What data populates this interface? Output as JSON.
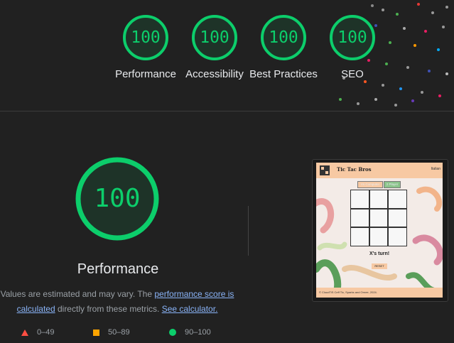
{
  "scores": [
    {
      "label": "Performance",
      "value": "100"
    },
    {
      "label": "Accessibility",
      "value": "100"
    },
    {
      "label": "Best Practices",
      "value": "100"
    },
    {
      "label": "SEO",
      "value": "100"
    }
  ],
  "score_fraction": 1.0,
  "main": {
    "score": "100",
    "title": "Performance",
    "note_prefix": "Values are estimated and may vary. The ",
    "note_link1": "performance score is calculated",
    "note_middle": " directly from these metrics. ",
    "note_link2": "See calculator."
  },
  "legend": [
    {
      "range": "0–49",
      "icon": "triangle-icon",
      "color": "#ff4e42"
    },
    {
      "range": "50–89",
      "icon": "square-icon",
      "color": "#ffa400"
    },
    {
      "range": "90–100",
      "icon": "circle-icon",
      "color": "#0cce6b"
    }
  ],
  "thumbnail": {
    "title": "Tic Tac Bros",
    "lang": "Italian",
    "btn_vs_computer": "Vs Computer",
    "btn_2_player": "2 Player",
    "turn_text": "X's turn!",
    "reset": "RESET",
    "footer": "© CloudTiS Ceff Tic, Sparks and Ornee, 2024."
  },
  "colors": {
    "pass": "#0cce6b",
    "background": "#212121"
  }
}
